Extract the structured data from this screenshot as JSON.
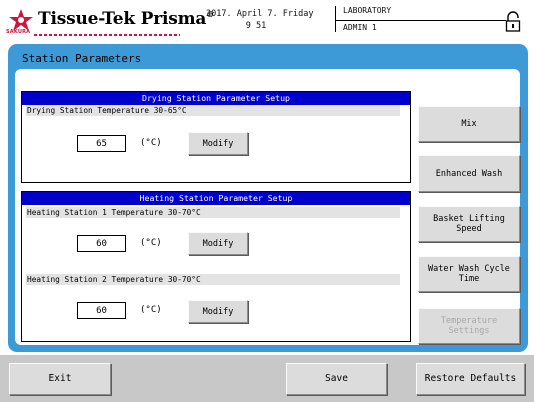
{
  "header": {
    "brand": "Tissue-Tek Prisma",
    "brand_mark": "®",
    "brand_sub": "SAKURA",
    "date": "2017. April 7. Friday",
    "time": "9 51",
    "lab": "LABORATORY",
    "user": "ADMIN 1",
    "lock_icon": "lock-icon"
  },
  "panel": {
    "title": "Station Parameters"
  },
  "drying": {
    "title": "Drying Station Parameter Setup",
    "label": "Drying Station Temperature   30-65°C",
    "value": "65",
    "unit": "(°C)",
    "modify": "Modify"
  },
  "heating": {
    "title": "Heating Station Parameter Setup",
    "station1": {
      "label": "Heating Station 1  Temperature   30-70°C",
      "value": "60",
      "unit": "(°C)",
      "modify": "Modify"
    },
    "station2": {
      "label": "Heating Station 2  Temperature   30-70°C",
      "value": "60",
      "unit": "(°C)",
      "modify": "Modify"
    }
  },
  "side_buttons": {
    "mix": "Mix",
    "enhanced_wash": "Enhanced Wash",
    "basket_lifting": [
      "Basket Lifting",
      "Speed"
    ],
    "water_wash": [
      "Water Wash Cycle",
      "Time"
    ],
    "temperature": [
      "Temperature",
      "Settings"
    ]
  },
  "bottom": {
    "exit": "Exit",
    "save": "Save",
    "restore": "Restore Defaults"
  },
  "colors": {
    "panel_blue": "#3d9ad6",
    "section_title": "#0000cc",
    "logo_red": "#d0143c"
  }
}
